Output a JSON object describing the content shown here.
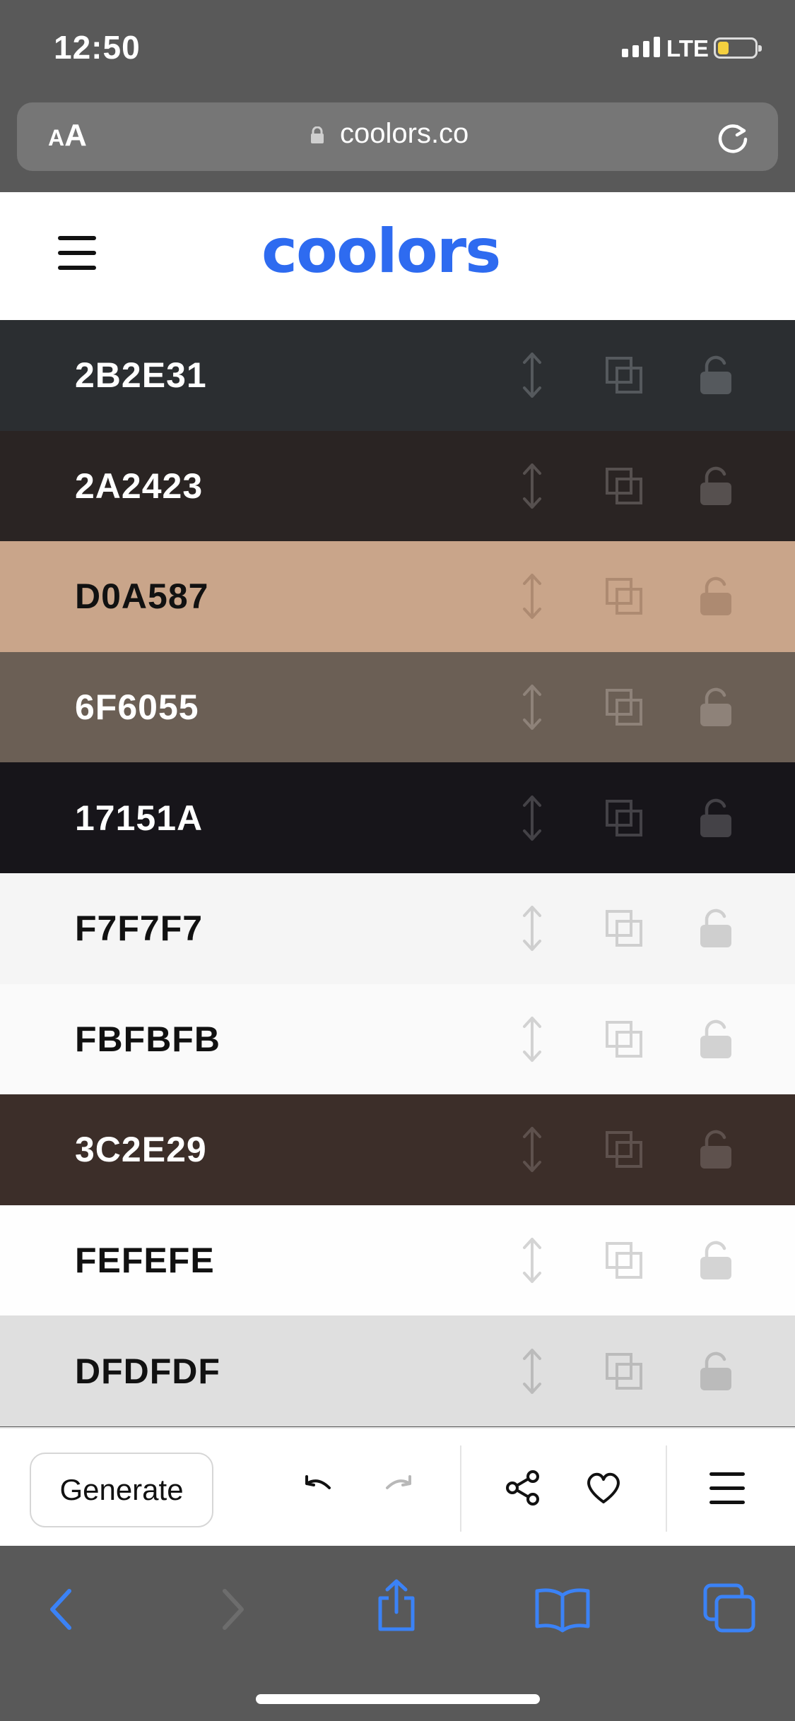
{
  "status_bar": {
    "time": "12:50",
    "network": "LTE"
  },
  "browser": {
    "text_size_small": "A",
    "text_size_large": "A",
    "url": "coolors.co"
  },
  "header": {
    "logo": "coolors"
  },
  "palette": [
    {
      "hex": "2B2E31",
      "bg": "#2B2E31",
      "text": "#ffffff",
      "icon": "#55595d"
    },
    {
      "hex": "2A2423",
      "bg": "#2A2423",
      "text": "#ffffff",
      "icon": "#56504f"
    },
    {
      "hex": "D0A587",
      "bg": "#C9A58A",
      "text": "#111111",
      "icon": "#ad8a71"
    },
    {
      "hex": "6F6055",
      "bg": "#6B5F55",
      "text": "#ffffff",
      "icon": "#8e8279"
    },
    {
      "hex": "17151A",
      "bg": "#17151A",
      "text": "#ffffff",
      "icon": "#444247"
    },
    {
      "hex": "F7F7F7",
      "bg": "#F5F5F5",
      "text": "#111111",
      "icon": "#cfcfcf"
    },
    {
      "hex": "FBFBFB",
      "bg": "#FAFAFA",
      "text": "#111111",
      "icon": "#d2d2d2"
    },
    {
      "hex": "3C2E29",
      "bg": "#3C2E29",
      "text": "#ffffff",
      "icon": "#5e514d"
    },
    {
      "hex": "FEFEFE",
      "bg": "#FEFEFE",
      "text": "#111111",
      "icon": "#d4d4d4"
    },
    {
      "hex": "DFDFDF",
      "bg": "#DFDFDF",
      "text": "#111111",
      "icon": "#bbbbbb"
    }
  ],
  "toolbar": {
    "generate_label": "Generate"
  },
  "colors": {
    "brand": "#2E6BF0",
    "ios_blue": "#3B82F6"
  }
}
